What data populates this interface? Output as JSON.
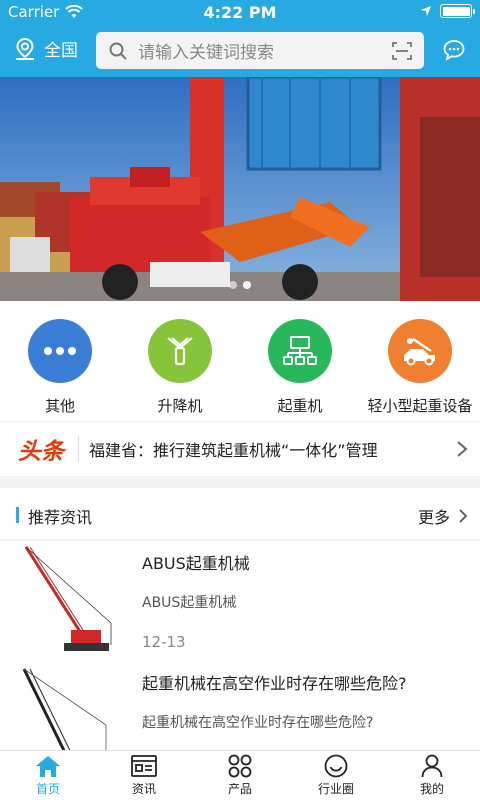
{
  "status": {
    "carrier": "Carrier",
    "time": "4:22 PM"
  },
  "nav": {
    "location": "全国",
    "search_placeholder": "请输入关键词搜索"
  },
  "banner": {
    "slides": 2,
    "active": 1
  },
  "categories": [
    {
      "label": "其他",
      "color": "#3a7fd5",
      "icon": "more-icon"
    },
    {
      "label": "升降机",
      "color": "#86c43a",
      "icon": "lift-icon"
    },
    {
      "label": "起重机",
      "color": "#28b85c",
      "icon": "network-icon"
    },
    {
      "label": "轻小型起重设备",
      "color": "#f08030",
      "icon": "tow-icon"
    }
  ],
  "headline": {
    "badge": "头条",
    "text": "福建省：推行建筑起重机械“一体化”管理"
  },
  "recommend": {
    "title": "推荐资讯",
    "more": "更多"
  },
  "news": [
    {
      "title": "ABUS起重机械",
      "subtitle": "ABUS起重机械",
      "date": "12-13"
    },
    {
      "title": "起重机械在高空作业时存在哪些危险?",
      "subtitle": "起重机械在高空作业时存在哪些危险?"
    }
  ],
  "tabs": [
    {
      "label": "首页",
      "icon": "home-icon",
      "active": true
    },
    {
      "label": "资讯",
      "icon": "news-icon"
    },
    {
      "label": "产品",
      "icon": "grid-icon"
    },
    {
      "label": "行业圈",
      "icon": "smile-icon"
    },
    {
      "label": "我的",
      "icon": "user-icon"
    }
  ],
  "colors": {
    "accent": "#27a9e1",
    "headline_badge": "#e8380d"
  }
}
